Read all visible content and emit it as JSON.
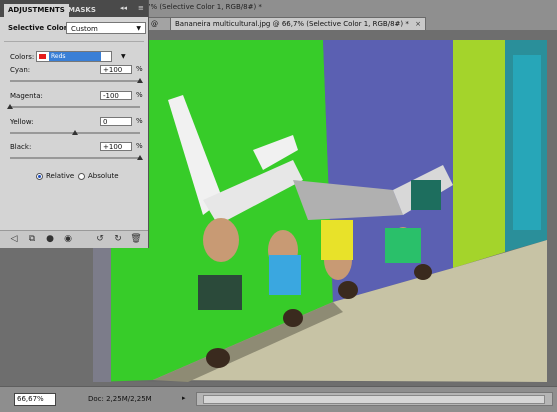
{
  "document": {
    "tab_cut_title": "7% (Selective Color 1, RGB/8#) *",
    "inactive_tab_label": "@",
    "active_tab_label": "Bananeira multicultural.jpg @ 66,7% (Selective Color 1, RGB/8#) *",
    "close_glyph": "×"
  },
  "panel": {
    "tabs": [
      "ADJUSTMENTS",
      "MASKS"
    ],
    "collapse_glyph": "◂◂",
    "menu_glyph": "≡",
    "title": "Selective Color",
    "preset_value": "Custom",
    "colors_label": "Colors:",
    "colors_value": "Reds",
    "sliders": [
      {
        "label": "Cyan:",
        "value": "+100",
        "unit": "%",
        "fraction": 1.0
      },
      {
        "label": "Magenta:",
        "value": "-100",
        "unit": "%",
        "fraction": 0.0
      },
      {
        "label": "Yellow:",
        "value": "0",
        "unit": "%",
        "fraction": 0.5
      },
      {
        "label": "Black:",
        "value": "+100",
        "unit": "%",
        "fraction": 1.0
      }
    ],
    "method_relative": "Relative",
    "method_absolute": "Absolute",
    "method_selected": "Relative",
    "footer_icons": [
      "back-arrow-icon",
      "clip-layer-icon",
      "visibility-icon",
      "view-previous-icon",
      "reset-icon",
      "delete-icon"
    ]
  },
  "status": {
    "zoom": "66,67%",
    "doc_info": "Doc: 2,25M/2,25M",
    "arrow": "▸"
  },
  "colors": {
    "green_wall": "#3bd42a",
    "blue_wall": "#5a61b6",
    "lime_wall": "#a6d52b",
    "cyan_door": "#27a6b8",
    "floor": "#c9c6a8"
  }
}
